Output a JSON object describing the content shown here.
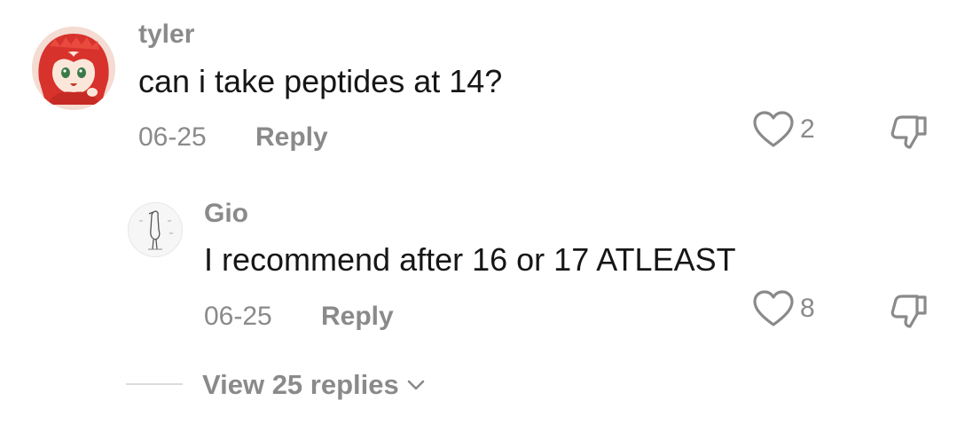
{
  "comment": {
    "username": "tyler",
    "text": "can i take peptides at 14?",
    "date": "06-25",
    "reply_label": "Reply",
    "likes": "2"
  },
  "reply": {
    "username": "Gio",
    "text": "I recommend after 16 or 17 ATLEAST",
    "date": "06-25",
    "reply_label": "Reply",
    "likes": "8"
  },
  "view_replies": {
    "label": "View 25 replies"
  },
  "icons": {
    "like": "heart-outline-icon",
    "dislike": "thumbs-down-outline-icon",
    "expand": "chevron-down-icon"
  },
  "colors": {
    "text_primary": "#161616",
    "text_secondary": "#8a8a8a",
    "divider": "#dcdcdc"
  }
}
